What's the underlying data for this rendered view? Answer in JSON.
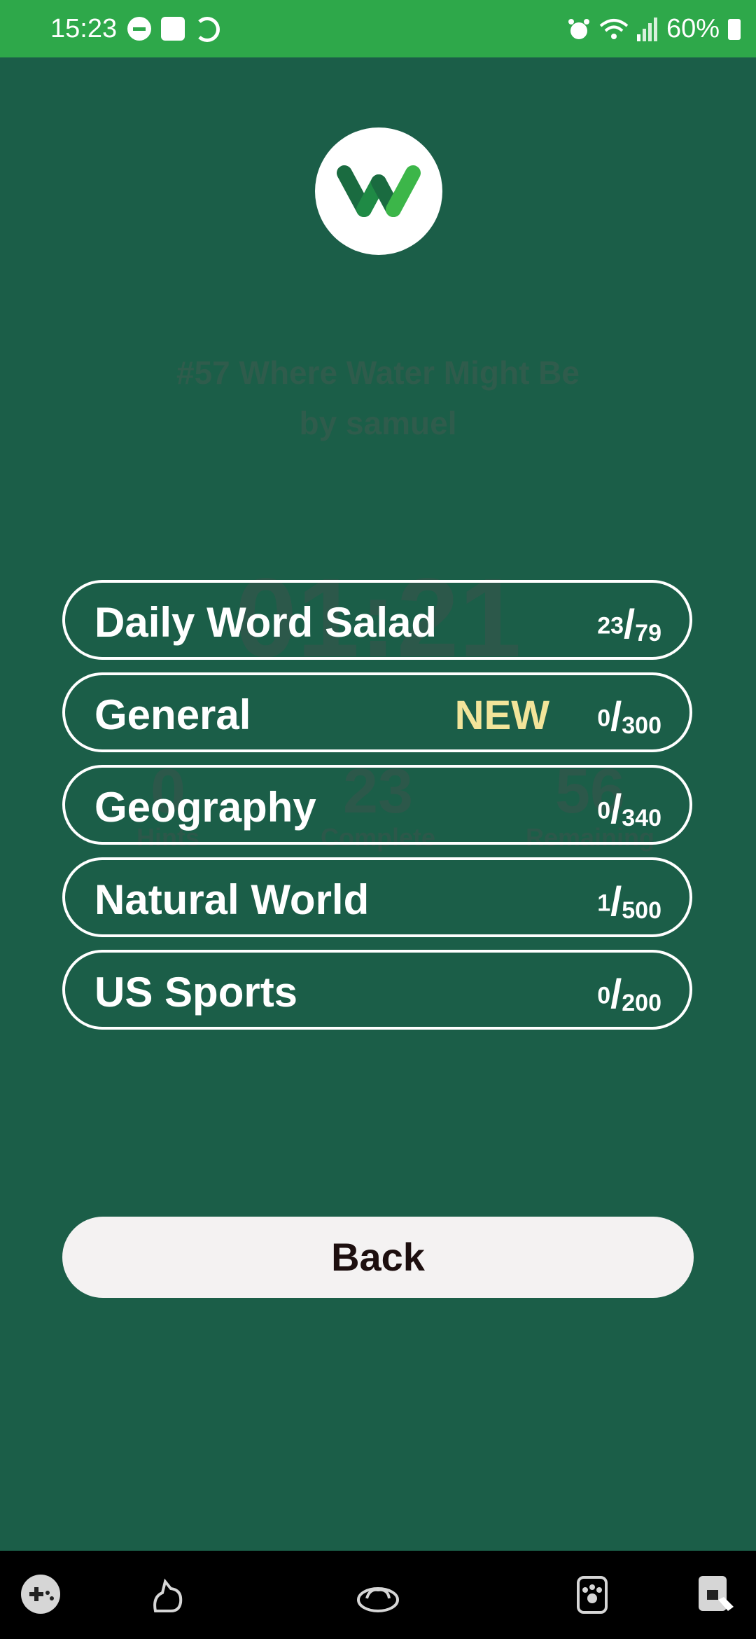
{
  "status_bar": {
    "time": "15:23",
    "battery": "60%"
  },
  "puzzle": {
    "title": "#57 Where Water Might Be",
    "author": "by samuel"
  },
  "background_stats": {
    "timer": "01:21",
    "hints": {
      "value": "0",
      "label": "Hints"
    },
    "complete": {
      "value": "23",
      "label": "Complete"
    },
    "remaining": {
      "value": "56",
      "label": "Remaining"
    }
  },
  "categories": [
    {
      "name": "Daily Word Salad",
      "done": "23",
      "total": "79",
      "badge": ""
    },
    {
      "name": "General",
      "done": "0",
      "total": "300",
      "badge": "NEW"
    },
    {
      "name": "Geography",
      "done": "0",
      "total": "340",
      "badge": ""
    },
    {
      "name": "Natural World",
      "done": "1",
      "total": "500",
      "badge": ""
    },
    {
      "name": "US Sports",
      "done": "0",
      "total": "200",
      "badge": ""
    }
  ],
  "back_label": "Back",
  "colors": {
    "status_bar": "#2ea84a",
    "background": "#1b5e48",
    "badge": "#f2e49a"
  },
  "nav_icons": [
    "games-icon",
    "cat-icon",
    "cat-bed-icon",
    "paw-icon",
    "touch-lock-icon"
  ]
}
